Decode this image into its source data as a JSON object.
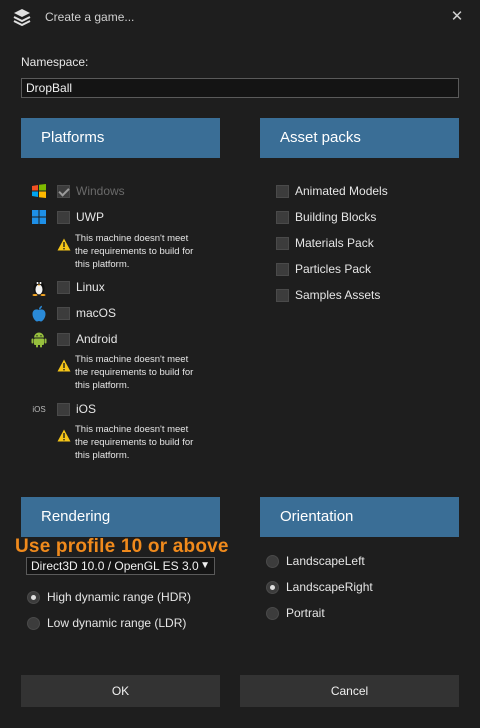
{
  "window": {
    "title": "Create a game...",
    "app_icon": "stacked-layers-icon",
    "close_icon": "close-icon",
    "close_glyph": "✕"
  },
  "namespace": {
    "label": "Namespace:",
    "value": "DropBall"
  },
  "platforms": {
    "header": "Platforms",
    "warning_lines": [
      "This machine doesn't meet",
      "the requirements to build for",
      "this platform."
    ],
    "items": [
      {
        "label": "Windows",
        "checked": true,
        "disabled": true,
        "icon": "windows-logo-icon"
      },
      {
        "label": "UWP",
        "checked": false,
        "disabled": false,
        "icon": "uwp-logo-icon"
      },
      {
        "label": "Linux",
        "checked": false,
        "disabled": false,
        "icon": "linux-penguin-icon"
      },
      {
        "label": "macOS",
        "checked": false,
        "disabled": false,
        "icon": "apple-icon"
      },
      {
        "label": "Android",
        "checked": false,
        "disabled": false,
        "icon": "android-icon"
      },
      {
        "label": "iOS",
        "checked": false,
        "disabled": false,
        "icon": "ios-icon",
        "icon_text": "iOS"
      }
    ]
  },
  "asset_packs": {
    "header": "Asset packs",
    "items": [
      {
        "label": "Animated Models",
        "checked": false
      },
      {
        "label": "Building Blocks",
        "checked": false
      },
      {
        "label": "Materials Pack",
        "checked": false
      },
      {
        "label": "Particles Pack",
        "checked": false
      },
      {
        "label": "Samples Assets",
        "checked": false
      }
    ]
  },
  "rendering": {
    "header": "Rendering",
    "note": "Use profile 10 or above",
    "profile_selected": "Direct3D 10.0 / OpenGL ES 3.0",
    "options": [
      {
        "label": "High dynamic range (HDR)",
        "selected": true
      },
      {
        "label": "Low dynamic range (LDR)",
        "selected": false
      }
    ]
  },
  "orientation": {
    "header": "Orientation",
    "options": [
      {
        "label": "LandscapeLeft",
        "selected": false
      },
      {
        "label": "LandscapeRight",
        "selected": true
      },
      {
        "label": "Portrait",
        "selected": false
      }
    ]
  },
  "buttons": {
    "ok": "OK",
    "cancel": "Cancel"
  },
  "colors": {
    "accent": "#3a6e96",
    "note": "#f08a1c",
    "warning": "#f5c518"
  }
}
